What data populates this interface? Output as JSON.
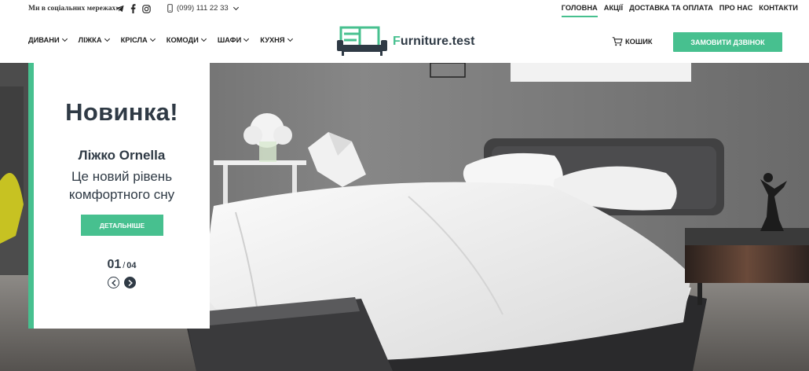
{
  "header": {
    "social_label": "Ми в соціальних мережах:",
    "social_icons": [
      "telegram-icon",
      "facebook-icon",
      "instagram-icon"
    ],
    "phone": "(099) 111 22 33",
    "top_nav": [
      "ГОЛОВНА",
      "АКЦІЇ",
      "ДОСТАВКА ТА ОПЛАТА",
      "ПРО НАС",
      "КОНТАКТИ"
    ],
    "active_top_nav": "ГОЛОВНА"
  },
  "main_nav": {
    "items": [
      {
        "label": "ДИВАНИ"
      },
      {
        "label": "ЛІЖКА"
      },
      {
        "label": "КРІСЛА"
      },
      {
        "label": "КОМОДИ"
      },
      {
        "label": "ШАФИ"
      },
      {
        "label": "КУХНЯ"
      }
    ]
  },
  "logo": {
    "text_first": "F",
    "text_rest": "urniture.test"
  },
  "cart": {
    "label": "КОШИК"
  },
  "call_button": {
    "label": "ЗАМОВИТИ ДЗВІНОК"
  },
  "slide": {
    "title": "Новинка!",
    "product": "Ліжко Ornella",
    "description": "Це новий рівень комфортного сну",
    "button": "ДЕТАЛЬНІШЕ",
    "current": "01",
    "separator": "/",
    "total": "04"
  },
  "colors": {
    "accent": "#47c08f",
    "dark": "#2f3a45"
  }
}
